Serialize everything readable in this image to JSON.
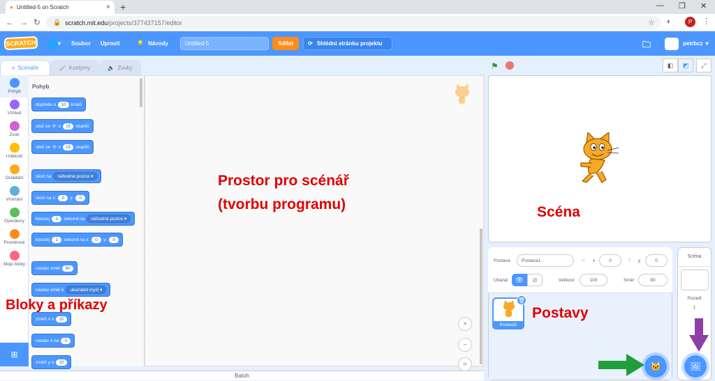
{
  "browser": {
    "tab_title": "Untitled-5 on Scratch",
    "url_host": "scratch.mit.edu",
    "url_path": "/projects/377437157/editor",
    "profile_initial": "P"
  },
  "menubar": {
    "logo": "SCRATCH",
    "file": "Soubor",
    "edit": "Upravit",
    "tutorials": "Návody",
    "project_title": "Untitled-5",
    "share": "Sdílet",
    "see_project": "Shlédni stránku projektu",
    "username": "petrbcz"
  },
  "tabs": {
    "code": "Scénáře",
    "costumes": "Kostýmy",
    "sounds": "Zvuky"
  },
  "categories": [
    {
      "label": "Pohyb",
      "color": "#4c97ff"
    },
    {
      "label": "Vzhled",
      "color": "#9966ff"
    },
    {
      "label": "Zvuk",
      "color": "#cf63cf"
    },
    {
      "label": "Události",
      "color": "#ffbf00"
    },
    {
      "label": "Ovládání",
      "color": "#ffab19"
    },
    {
      "label": "Vnímání",
      "color": "#5cb1d6"
    },
    {
      "label": "Operátory",
      "color": "#59c059"
    },
    {
      "label": "Proměnné",
      "color": "#ff8c1a"
    },
    {
      "label": "Moje bloky",
      "color": "#ff6680"
    }
  ],
  "palette": {
    "heading": "Pohyb",
    "b1": {
      "a": "dopředu o",
      "v": "10",
      "b": "kroků"
    },
    "b2": {
      "a": "otoč se",
      "icon": "⟳",
      "b": "o",
      "v": "15",
      "c": "stupňů"
    },
    "b3": {
      "a": "otoč se",
      "icon": "⟲",
      "b": "o",
      "v": "15",
      "c": "stupňů"
    },
    "b4": {
      "a": "skoč na",
      "d": "náhodná pozice"
    },
    "b5": {
      "a": "skoč na x:",
      "x": "0",
      "b": "y:",
      "y": "0"
    },
    "b6": {
      "a": "klouzej",
      "v": "1",
      "b": "sekund na",
      "d": "náhodná pozice"
    },
    "b7": {
      "a": "klouzej",
      "v": "1",
      "b": "sekund na x:",
      "x": "0",
      "c": "y:",
      "y": "0"
    },
    "b8": {
      "a": "nastav směr",
      "v": "90"
    },
    "b9": {
      "a": "nastav směr k",
      "d": "ukazateli myši"
    },
    "b10": {
      "a": "změň x o",
      "v": "10"
    },
    "b11": {
      "a": "nastav x na",
      "v": "0"
    },
    "b12": {
      "a": "změň y o",
      "v": "10"
    }
  },
  "zoom": {
    "in": "+",
    "out": "−",
    "reset": "="
  },
  "backpack": "Batoh",
  "sprite_info": {
    "sprite_label": "Postava",
    "sprite_name": "Postava1",
    "x_label": "x",
    "x": "0",
    "y_label": "y",
    "y": "0",
    "show_label": "Ukázat",
    "size_label": "Velikost",
    "size": "100",
    "direction_label": "Směr",
    "direction": "90"
  },
  "sprites": [
    {
      "name": "Postava1"
    }
  ],
  "stage_panel": {
    "title": "Scéna",
    "backdrops_label": "Pozadí",
    "backdrops_count": "1"
  },
  "annotations": {
    "blocks": "Bloky a příkazy",
    "script_area_line1": "Prostor pro scénář",
    "script_area_line2": "(tvorbu programu)",
    "stage": "Scéna",
    "sprites": "Postavy"
  },
  "colors": {
    "motion": "#4c97ff",
    "orange": "#ff8c1a",
    "annotation_red": "#e00000",
    "arrow_green": "#1f9e3a",
    "arrow_purple": "#8e3fa8"
  }
}
